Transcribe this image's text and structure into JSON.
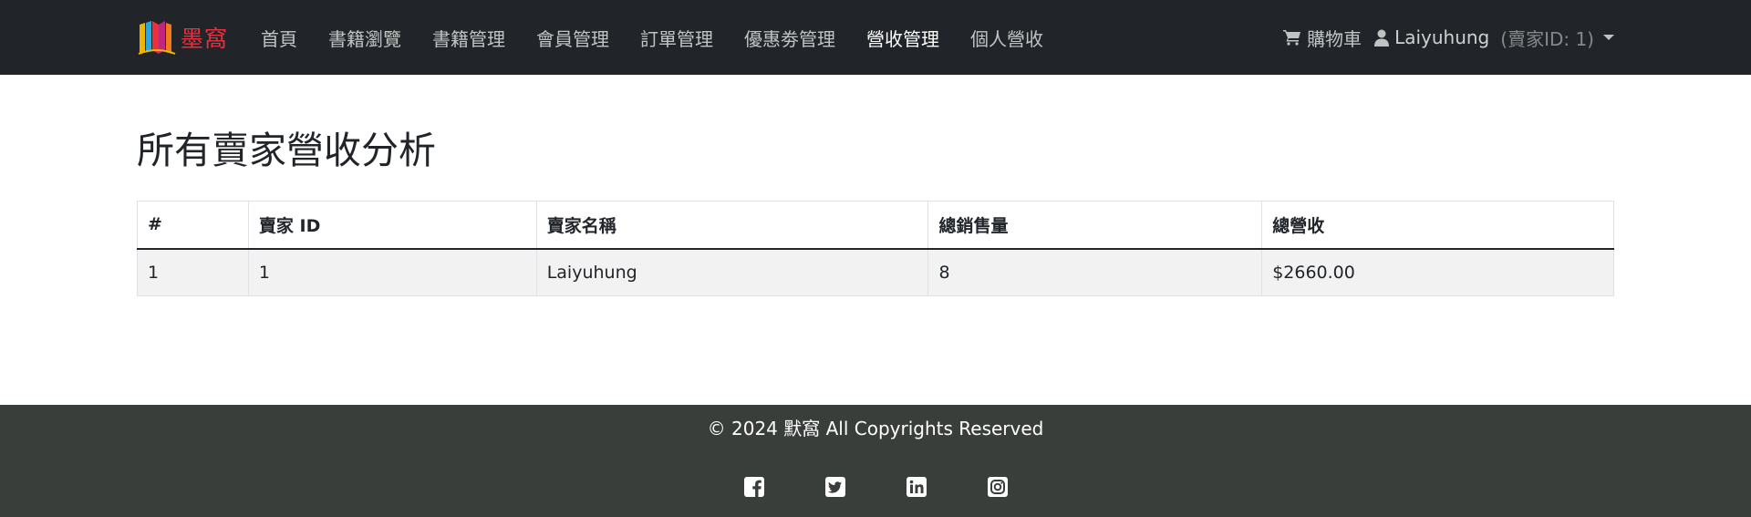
{
  "brand": {
    "name": "墨窩",
    "color": "#e8303f"
  },
  "nav": {
    "items": [
      {
        "label": "首頁",
        "active": false
      },
      {
        "label": "書籍瀏覽",
        "active": false
      },
      {
        "label": "書籍管理",
        "active": false
      },
      {
        "label": "會員管理",
        "active": false
      },
      {
        "label": "訂單管理",
        "active": false
      },
      {
        "label": "優惠劵管理",
        "active": false
      },
      {
        "label": "營收管理",
        "active": true
      },
      {
        "label": "個人營收",
        "active": false
      }
    ],
    "cart_label": "購物車",
    "cart_icon": "shopping-cart-icon",
    "user_icon": "user-icon",
    "user_name": "Laiyuhung",
    "user_id_text": "(賣家ID: 1)"
  },
  "main": {
    "title": "所有賣家營收分析",
    "table": {
      "headers": [
        "#",
        "賣家 ID",
        "賣家名稱",
        "總銷售量",
        "總營收"
      ],
      "rows": [
        [
          "1",
          "1",
          "Laiyuhung",
          "8",
          "$2660.00"
        ]
      ]
    }
  },
  "footer": {
    "copyright": "© 2024 默窩 All Copyrights Reserved",
    "social_icons": [
      "facebook-icon",
      "twitter-icon",
      "linkedin-icon",
      "instagram-icon"
    ]
  },
  "colors": {
    "navbar_bg": "#212529",
    "footer_bg": "#393e3b",
    "row_bg": "#f2f2f2"
  }
}
